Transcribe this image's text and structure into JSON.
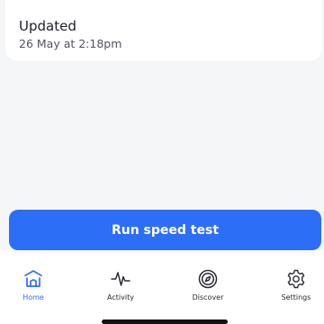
{
  "updated": {
    "title": "Updated",
    "timestamp": "26 May at 2:18pm"
  },
  "actions": {
    "run_label": "Run speed test"
  },
  "tabs": [
    {
      "label": "Home",
      "icon": "home-icon",
      "active": true
    },
    {
      "label": "Activity",
      "icon": "activity-pulse-icon",
      "active": false
    },
    {
      "label": "Discover",
      "icon": "compass-icon",
      "active": false
    },
    {
      "label": "Settings",
      "icon": "gear-icon",
      "active": false
    }
  ],
  "colors": {
    "accent": "#2d6ef6",
    "background": "#f5f6f8",
    "surface": "#ffffff",
    "text": "#1d1e27",
    "secondary_text": "#51535f"
  }
}
